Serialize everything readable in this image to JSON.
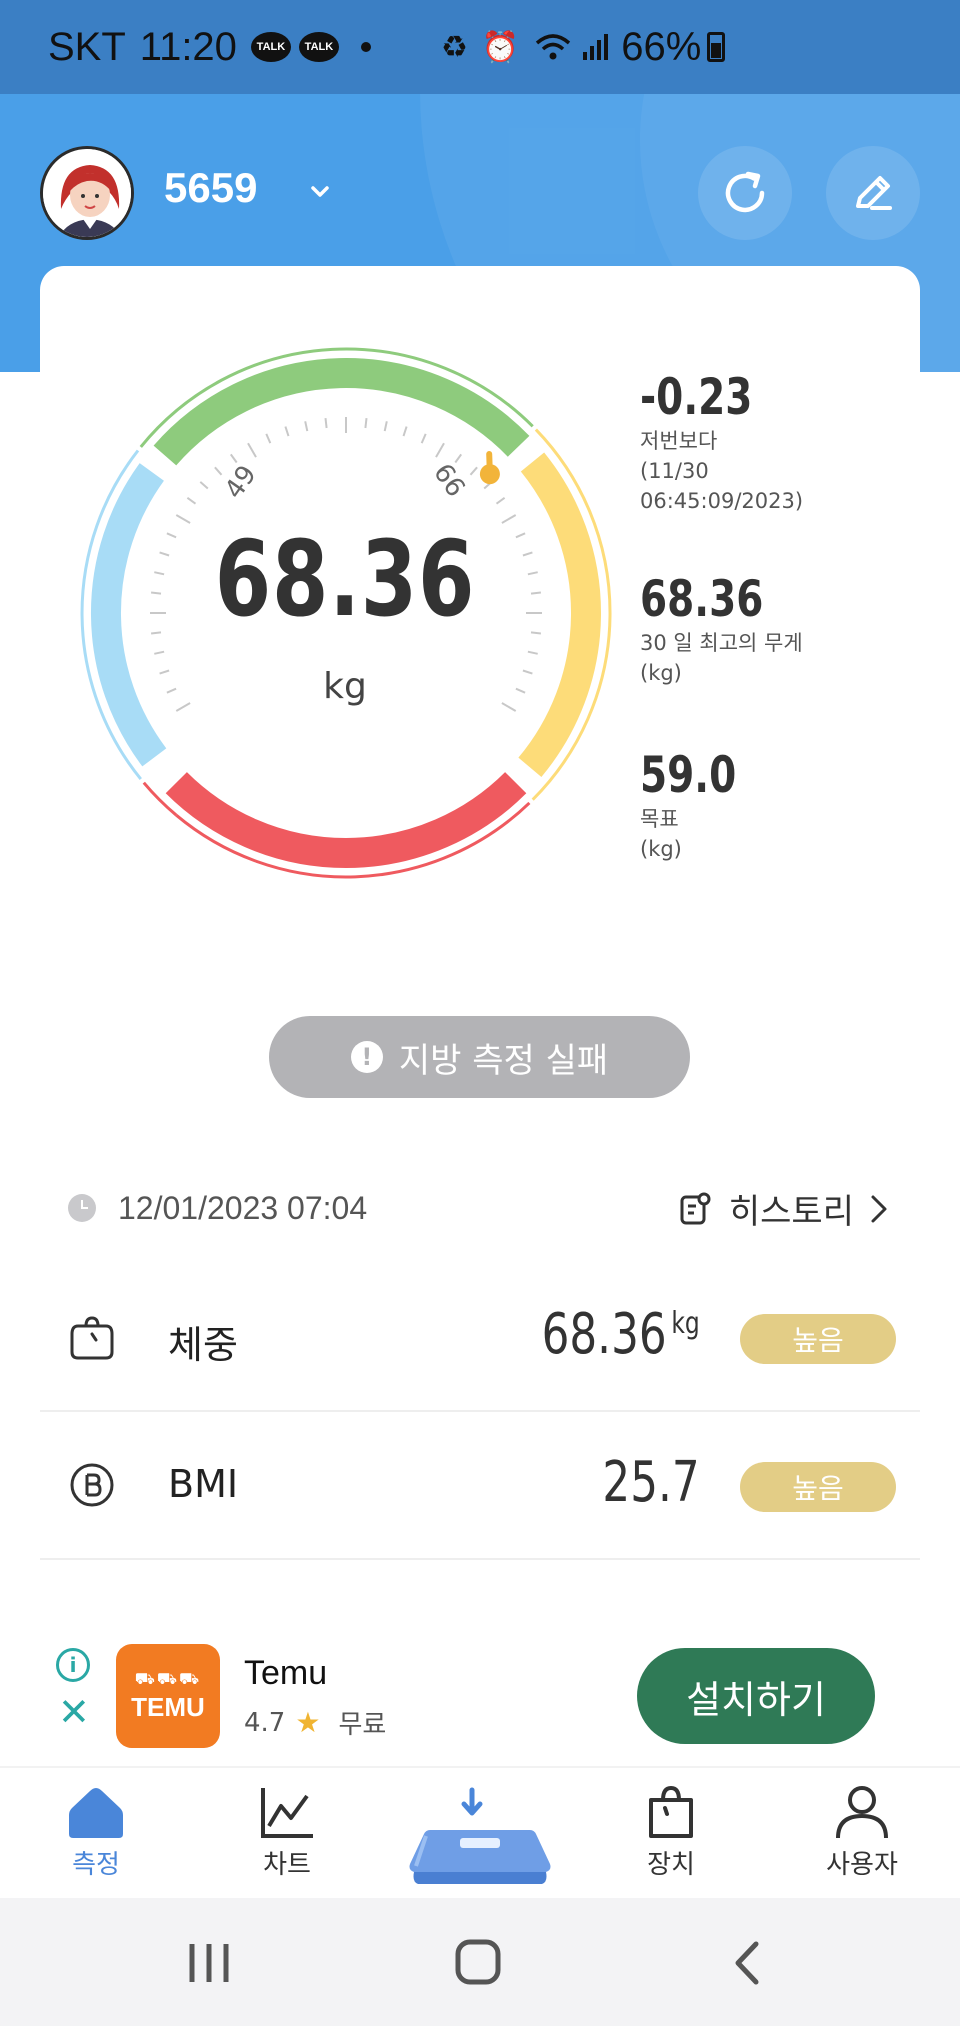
{
  "status_bar": {
    "carrier": "SKT",
    "time": "11:20",
    "talk_badge": "TALK",
    "battery": "66%"
  },
  "header": {
    "user_name": "5659"
  },
  "gauge": {
    "weight": "68.36",
    "unit": "kg",
    "tick_low": "49",
    "tick_high": "66"
  },
  "stats": {
    "diff_value": "-0.23",
    "diff_label": "저번보다",
    "diff_date_line1": "(11/30",
    "diff_date_line2": "06:45:09/2023)",
    "max_value": "68.36",
    "max_label": "30 일 최고의 무게",
    "max_unit": "(kg)",
    "goal_value": "59.0",
    "goal_label": "목표",
    "goal_unit": "(kg)"
  },
  "fail_message": "지방 측정 실패",
  "measured_at": "12/01/2023 07:04",
  "history_label": "히스토리",
  "metrics": [
    {
      "label": "체중",
      "value": "68.36",
      "unit": "kg",
      "status": "높음"
    },
    {
      "label": "BMI",
      "value": "25.7",
      "unit": "",
      "status": "높음"
    }
  ],
  "ad": {
    "app_name": "Temu",
    "logo_text": "TEMU",
    "rating": "4.7",
    "price": "무료",
    "install_label": "설치하기"
  },
  "bottom_nav": {
    "measure": "측정",
    "chart": "차트",
    "device": "장치",
    "user": "사용자"
  },
  "colors": {
    "header_blue": "#4a9fe8",
    "accent_blue": "#4a86d9",
    "badge_gold": "#e3cd86",
    "gauge_green": "#8ecb7d",
    "gauge_yellow": "#fddc79",
    "gauge_red": "#ef5a5f",
    "gauge_blue": "#a8dcf6",
    "install_green": "#2f7a56"
  }
}
